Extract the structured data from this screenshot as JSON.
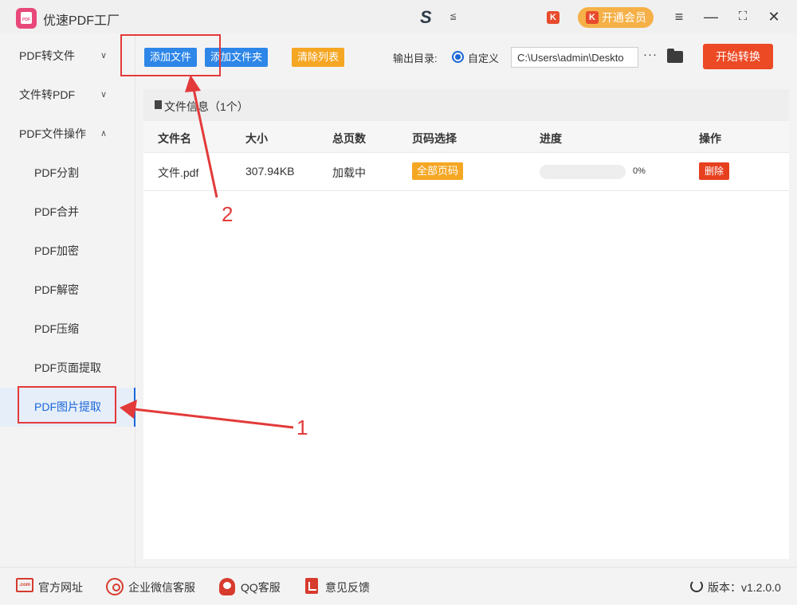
{
  "app": {
    "title": "优速PDF工厂",
    "center_logo": "S",
    "center_logo_sub": "≦",
    "k_badge": "K",
    "vip_label": "开通会员",
    "window_controls": {
      "menu": "≡",
      "minimize": "—",
      "maximize": "⛶",
      "close": "✕"
    }
  },
  "sidebar": {
    "items": [
      {
        "label": "PDF转文件",
        "chevron": "∨"
      },
      {
        "label": "文件转PDF",
        "chevron": "∨"
      },
      {
        "label": "PDF文件操作",
        "chevron": "∧"
      },
      {
        "label": "PDF分割"
      },
      {
        "label": "PDF合并"
      },
      {
        "label": "PDF加密"
      },
      {
        "label": "PDF解密"
      },
      {
        "label": "PDF压缩"
      },
      {
        "label": "PDF页面提取"
      },
      {
        "label": "PDF图片提取",
        "active": true
      }
    ]
  },
  "toolbar": {
    "add_file": "添加文件",
    "add_folder": "添加文件夹",
    "clear_list": "清除列表",
    "output_label": "输出目录:",
    "radio_label": "自定义",
    "output_path": "C:\\Users\\admin\\Deskto",
    "more": "···",
    "start": "开始转换"
  },
  "file_panel": {
    "title": "文件信息（1个）",
    "columns": [
      "文件名",
      "大小",
      "总页数",
      "页码选择",
      "进度",
      "操作"
    ],
    "rows": [
      {
        "name": "文件.pdf",
        "size": "307.94KB",
        "pages": "加载中",
        "page_select": "全部页码",
        "progress": 0,
        "progress_text": "0%",
        "action": "删除"
      }
    ]
  },
  "footer": {
    "website_icon": ".com",
    "website": "官方网址",
    "wechat": "企业微信客服",
    "qq": "QQ客服",
    "feedback": "意见反馈",
    "version": "版本：v1.2.0.0"
  },
  "annotations": {
    "label_1": "1",
    "label_2": "2"
  },
  "colors": {
    "accent_blue": "#2d86e8",
    "orange": "#f5a623",
    "start_red": "#ec4a25",
    "annotation_red": "#e33a3a"
  }
}
